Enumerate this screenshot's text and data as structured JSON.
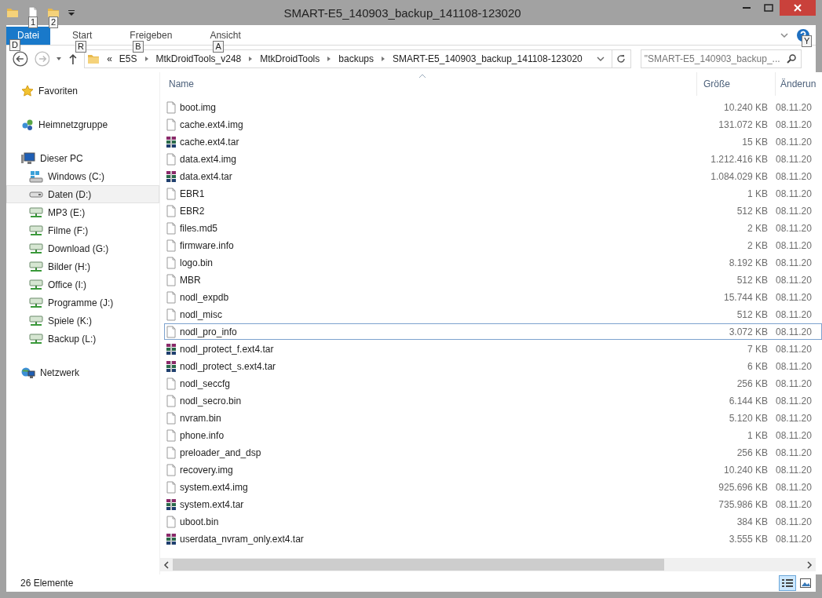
{
  "window": {
    "title": "SMART-E5_140903_backup_141108-123020"
  },
  "quick_access": [
    {
      "kind": "properties",
      "key_tip": "1"
    },
    {
      "kind": "new-folder",
      "key_tip": "2"
    }
  ],
  "ribbon": {
    "tabs": [
      {
        "label": "Datei",
        "kind": "file",
        "key_tip": "D"
      },
      {
        "label": "Start",
        "kind": "tab",
        "key_tip": "R"
      },
      {
        "label": "Freigeben",
        "kind": "tab",
        "key_tip": "B"
      },
      {
        "label": "Ansicht",
        "kind": "tab",
        "key_tip": "A"
      }
    ],
    "help_key_tip": "Y"
  },
  "address_bar": {
    "overflow": "«",
    "breadcrumbs": [
      "E5S",
      "MtkDroidTools_v248",
      "MtkDroidTools",
      "backups",
      "SMART-E5_140903_backup_141108-123020"
    ]
  },
  "search": {
    "placeholder": "\"SMART-E5_140903_backup_..."
  },
  "sidebar": {
    "items": [
      {
        "label": "Favoriten",
        "kind": "favorites",
        "selected": false
      },
      {
        "label": "Heimnetzgruppe",
        "kind": "homegroup",
        "selected": false
      },
      {
        "label": "Dieser PC",
        "kind": "pc",
        "selected": false,
        "children": [
          {
            "label": "Windows (C:)",
            "kind": "system-drive",
            "selected": false
          },
          {
            "label": "Daten (D:)",
            "kind": "drive",
            "selected": true
          },
          {
            "label": "MP3 (E:)",
            "kind": "network-drive",
            "selected": false
          },
          {
            "label": "Filme (F:)",
            "kind": "network-drive",
            "selected": false
          },
          {
            "label": "Download (G:)",
            "kind": "network-drive",
            "selected": false
          },
          {
            "label": "Bilder (H:)",
            "kind": "network-drive",
            "selected": false
          },
          {
            "label": "Office (I:)",
            "kind": "network-drive",
            "selected": false
          },
          {
            "label": "Programme (J:)",
            "kind": "network-drive",
            "selected": false
          },
          {
            "label": "Spiele (K:)",
            "kind": "network-drive",
            "selected": false
          },
          {
            "label": "Backup (L:)",
            "kind": "network-drive",
            "selected": false
          }
        ]
      },
      {
        "label": "Netzwerk",
        "kind": "network",
        "selected": false
      }
    ]
  },
  "file_list": {
    "columns": [
      "Name",
      "Größe",
      "Änderun"
    ],
    "rows": [
      {
        "name": "boot.img",
        "kind": "file",
        "size": "10.240 KB",
        "date": "08.11.20",
        "selected": false
      },
      {
        "name": "cache.ext4.img",
        "kind": "file",
        "size": "131.072 KB",
        "date": "08.11.20",
        "selected": false
      },
      {
        "name": "cache.ext4.tar",
        "kind": "archive",
        "size": "15 KB",
        "date": "08.11.20",
        "selected": false
      },
      {
        "name": "data.ext4.img",
        "kind": "file",
        "size": "1.212.416 KB",
        "date": "08.11.20",
        "selected": false
      },
      {
        "name": "data.ext4.tar",
        "kind": "archive",
        "size": "1.084.029 KB",
        "date": "08.11.20",
        "selected": false
      },
      {
        "name": "EBR1",
        "kind": "file",
        "size": "1 KB",
        "date": "08.11.20",
        "selected": false
      },
      {
        "name": "EBR2",
        "kind": "file",
        "size": "512 KB",
        "date": "08.11.20",
        "selected": false
      },
      {
        "name": "files.md5",
        "kind": "file",
        "size": "2 KB",
        "date": "08.11.20",
        "selected": false
      },
      {
        "name": "firmware.info",
        "kind": "file",
        "size": "2 KB",
        "date": "08.11.20",
        "selected": false
      },
      {
        "name": "logo.bin",
        "kind": "file",
        "size": "8.192 KB",
        "date": "08.11.20",
        "selected": false
      },
      {
        "name": "MBR",
        "kind": "file",
        "size": "512 KB",
        "date": "08.11.20",
        "selected": false
      },
      {
        "name": "nodl_expdb",
        "kind": "file",
        "size": "15.744 KB",
        "date": "08.11.20",
        "selected": false
      },
      {
        "name": "nodl_misc",
        "kind": "file",
        "size": "512 KB",
        "date": "08.11.20",
        "selected": false
      },
      {
        "name": "nodl_pro_info",
        "kind": "file",
        "size": "3.072 KB",
        "date": "08.11.20",
        "selected": true
      },
      {
        "name": "nodl_protect_f.ext4.tar",
        "kind": "archive",
        "size": "7 KB",
        "date": "08.11.20",
        "selected": false
      },
      {
        "name": "nodl_protect_s.ext4.tar",
        "kind": "archive",
        "size": "6 KB",
        "date": "08.11.20",
        "selected": false
      },
      {
        "name": "nodl_seccfg",
        "kind": "file",
        "size": "256 KB",
        "date": "08.11.20",
        "selected": false
      },
      {
        "name": "nodl_secro.bin",
        "kind": "file",
        "size": "6.144 KB",
        "date": "08.11.20",
        "selected": false
      },
      {
        "name": "nvram.bin",
        "kind": "file",
        "size": "5.120 KB",
        "date": "08.11.20",
        "selected": false
      },
      {
        "name": "phone.info",
        "kind": "file",
        "size": "1 KB",
        "date": "08.11.20",
        "selected": false
      },
      {
        "name": "preloader_and_dsp",
        "kind": "file",
        "size": "256 KB",
        "date": "08.11.20",
        "selected": false
      },
      {
        "name": "recovery.img",
        "kind": "file",
        "size": "10.240 KB",
        "date": "08.11.20",
        "selected": false
      },
      {
        "name": "system.ext4.img",
        "kind": "file",
        "size": "925.696 KB",
        "date": "08.11.20",
        "selected": false
      },
      {
        "name": "system.ext4.tar",
        "kind": "archive",
        "size": "735.986 KB",
        "date": "08.11.20",
        "selected": false
      },
      {
        "name": "uboot.bin",
        "kind": "file",
        "size": "384 KB",
        "date": "08.11.20",
        "selected": false
      },
      {
        "name": "userdata_nvram_only.ext4.tar",
        "kind": "archive",
        "size": "3.555 KB",
        "date": "08.11.20",
        "selected": false
      }
    ]
  },
  "status_bar": {
    "count": "26 Elemente",
    "views": [
      {
        "kind": "details",
        "selected": true
      },
      {
        "kind": "large-icons",
        "selected": false
      }
    ]
  }
}
